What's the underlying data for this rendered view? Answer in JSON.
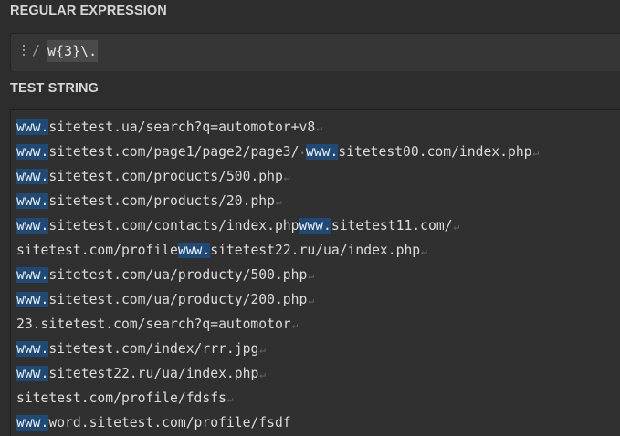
{
  "regex_section": {
    "title": "REGULAR EXPRESSION",
    "delimiter": "/",
    "pattern": "w{3}\\."
  },
  "test_section": {
    "title": "TEST STRING",
    "eol_symbol": "↵",
    "space_symbol": "•",
    "lines": [
      {
        "segments": [
          {
            "text": "www.",
            "match": true
          },
          {
            "text": "sitetest.ua/search?q=automotor+v8",
            "match": false
          }
        ],
        "eol": true
      },
      {
        "segments": [
          {
            "text": "www.",
            "match": true
          },
          {
            "text": "sitetest.com/page1/page2/page3/",
            "match": false
          },
          {
            "text": "•",
            "match": false,
            "space_marker": true
          },
          {
            "text": "www.",
            "match": true
          },
          {
            "text": "sitetest00.com/index.php",
            "match": false
          }
        ],
        "eol": true
      },
      {
        "segments": [
          {
            "text": "www.",
            "match": true
          },
          {
            "text": "sitetest.com/products/500.php",
            "match": false
          }
        ],
        "eol": true
      },
      {
        "segments": [
          {
            "text": "www.",
            "match": true
          },
          {
            "text": "sitetest.com/products/20.php",
            "match": false
          }
        ],
        "eol": true
      },
      {
        "segments": [
          {
            "text": "www.",
            "match": true
          },
          {
            "text": "sitetest.com/contacts/index.php",
            "match": false
          },
          {
            "text": "www.",
            "match": true
          },
          {
            "text": "sitetest11.com/",
            "match": false
          }
        ],
        "eol": true
      },
      {
        "segments": [
          {
            "text": "sitetest.com/profile",
            "match": false
          },
          {
            "text": "www.",
            "match": true
          },
          {
            "text": "sitetest22.ru/ua/index.php",
            "match": false
          }
        ],
        "eol": true
      },
      {
        "segments": [
          {
            "text": "www.",
            "match": true
          },
          {
            "text": "sitetest.com/ua/producty/500.php",
            "match": false
          }
        ],
        "eol": true
      },
      {
        "segments": [
          {
            "text": "www.",
            "match": true
          },
          {
            "text": "sitetest.com/ua/producty/200.php",
            "match": false
          }
        ],
        "eol": true
      },
      {
        "segments": [
          {
            "text": "23.sitetest.com/search?q=automotor",
            "match": false
          }
        ],
        "eol": true
      },
      {
        "segments": [
          {
            "text": "www.",
            "match": true
          },
          {
            "text": "sitetest.com/index/rrr.jpg",
            "match": false
          }
        ],
        "eol": true
      },
      {
        "segments": [
          {
            "text": "www.",
            "match": true
          },
          {
            "text": "sitetest22.ru/ua/index.php",
            "match": false
          }
        ],
        "eol": true
      },
      {
        "segments": [
          {
            "text": "sitetest.com/profile/fdsfs",
            "match": false
          }
        ],
        "eol": true
      },
      {
        "segments": [
          {
            "text": "www.",
            "match": true
          },
          {
            "text": "word.sitetest.com/profile/fsdf",
            "match": false
          }
        ],
        "eol": false
      }
    ]
  },
  "colors": {
    "background": "#2d2d2d",
    "match_highlight": "#1f4a76",
    "text": "#dcdcdc",
    "whitespace_marker": "#6b6b6b"
  }
}
